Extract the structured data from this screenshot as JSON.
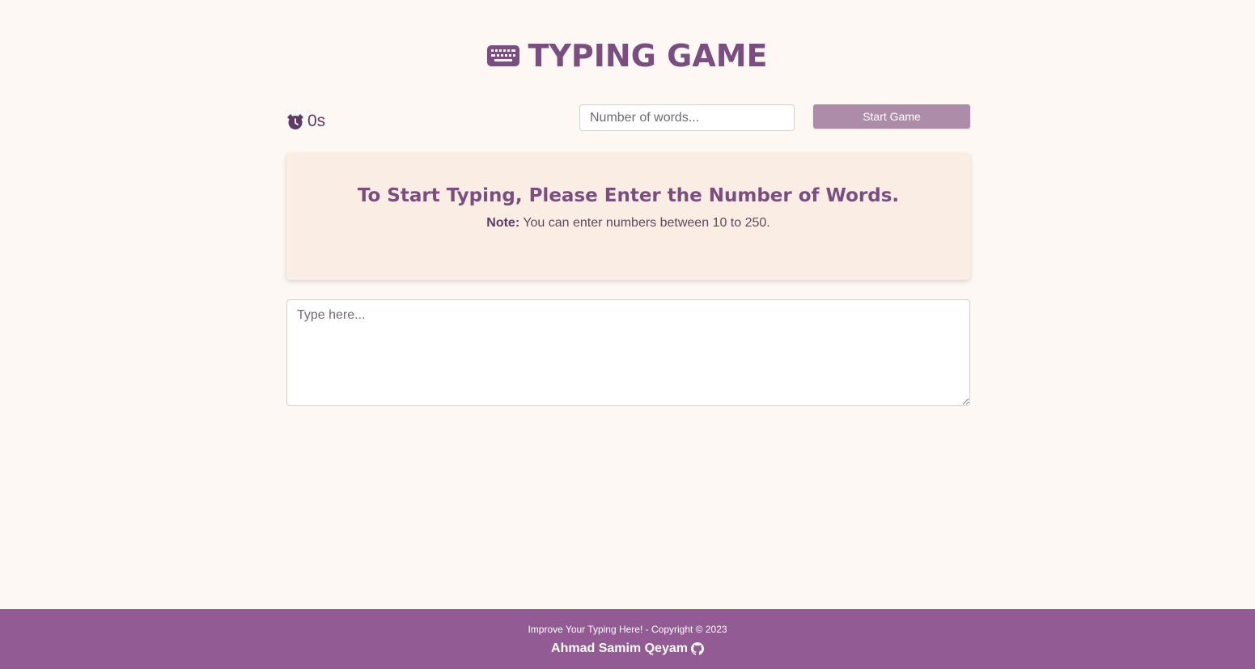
{
  "app": {
    "title": "TYPING GAME",
    "icon": "keyboard-icon"
  },
  "controls": {
    "timer_icon": "alarm-clock-icon",
    "timer_value": "0s",
    "word_count_placeholder": "Number of words...",
    "start_button_label": "Start Game"
  },
  "panel": {
    "heading": "To Start Typing, Please Enter the Number of Words.",
    "note_label": "Note:",
    "note_text": "You can enter numbers between 10 to 250."
  },
  "typing_area": {
    "placeholder": "Type here..."
  },
  "footer": {
    "copyright": "Improve Your Typing Here! - Copyright © 2023",
    "author": "Ahmad Samim Qeyam",
    "author_icon": "github-icon"
  },
  "colors": {
    "background": "#fef8f4",
    "title": "#7a4f7f",
    "button": "#ad8ca9",
    "panel": "#faede4",
    "footer": "#935b93"
  }
}
